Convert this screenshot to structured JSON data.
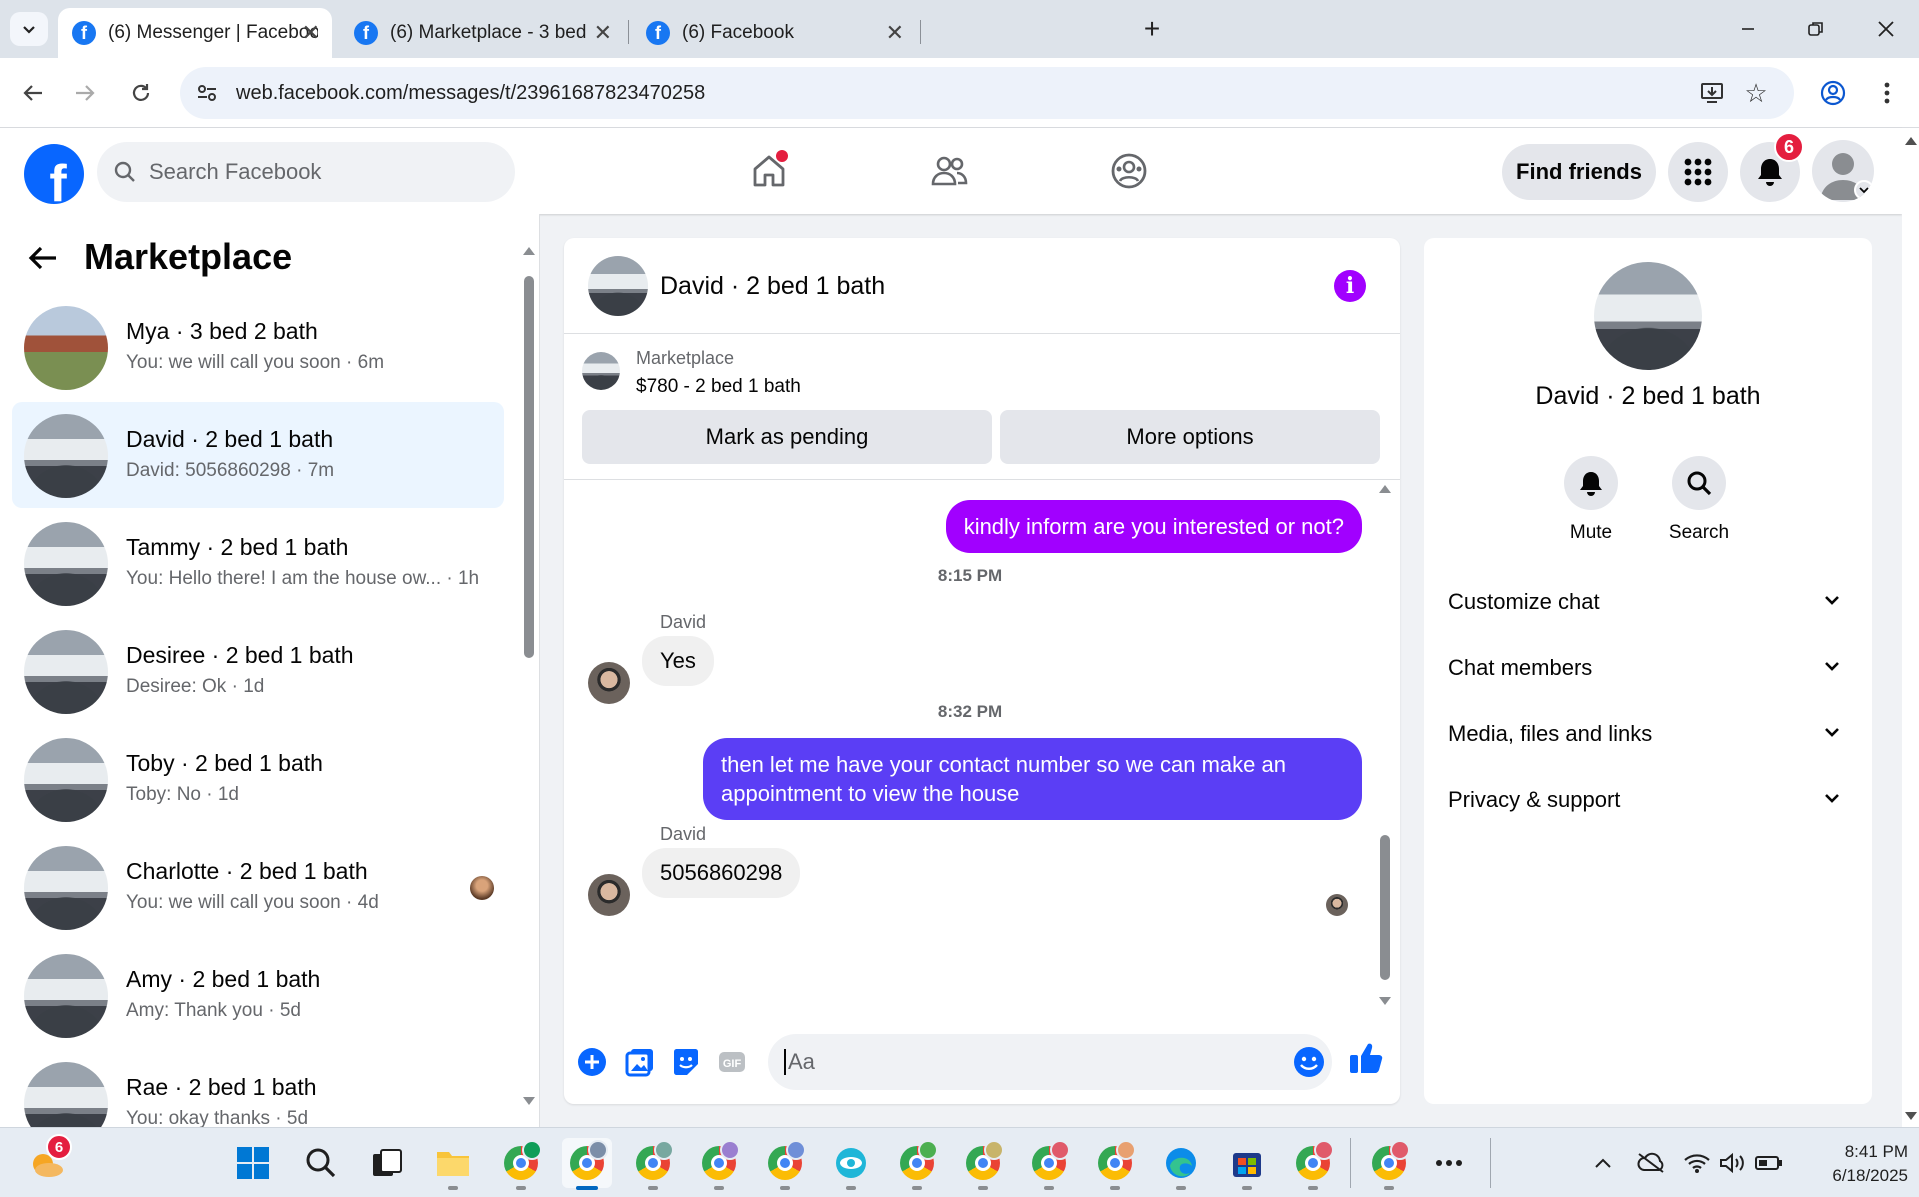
{
  "browser": {
    "tabs": [
      {
        "title": "(6) Messenger | Facebook",
        "active": true
      },
      {
        "title": "(6) Marketplace - 3 bed 2 bath |",
        "active": false
      },
      {
        "title": "(6) Facebook",
        "active": false
      }
    ],
    "url": "web.facebook.com/messages/t/23961687823470258"
  },
  "header": {
    "search_placeholder": "Search Facebook",
    "find_friends": "Find friends",
    "notif_count": "6"
  },
  "sidebar": {
    "title": "Marketplace",
    "conversations": [
      {
        "name": "Mya · 3 bed 2 bath",
        "preview": "You: we will call you soon · 6m",
        "active": false
      },
      {
        "name": "David · 2 bed 1 bath",
        "preview": "David: 5056860298 · 7m",
        "active": true
      },
      {
        "name": "Tammy · 2 bed 1 bath",
        "preview": "You: Hello there! I am the house ow... · 1h",
        "active": false
      },
      {
        "name": "Desiree · 2 bed 1 bath",
        "preview": "Desiree: Ok · 1d",
        "active": false
      },
      {
        "name": "Toby · 2 bed 1 bath",
        "preview": "Toby: No · 1d",
        "active": false
      },
      {
        "name": "Charlotte · 2 bed 1 bath",
        "preview": "You: we will call you soon · 4d",
        "active": false
      },
      {
        "name": "Amy · 2 bed 1 bath",
        "preview": "Amy: Thank you · 5d",
        "active": false
      },
      {
        "name": "Rae · 2 bed 1 bath",
        "preview": "You: okay thanks · 5d",
        "active": false
      }
    ]
  },
  "chat": {
    "title": "David · 2 bed 1 bath",
    "listing_source": "Marketplace",
    "listing_price": "$780 - 2 bed 1 bath",
    "mark_pending": "Mark as pending",
    "more_options": "More options",
    "messages": {
      "out1": "kindly inform are you interested or not?",
      "time1": "8:15 PM",
      "sender1": "David",
      "in1": "Yes",
      "time2": "8:32 PM",
      "out2": "then let me have your contact number so we can make an appointment to view the house",
      "sender2": "David",
      "in2": "5056860298"
    },
    "input_placeholder": "Aa",
    "colors": {
      "out_bubble_1": "#a100ff",
      "out_bubble_2": "#5b3ef5"
    }
  },
  "details": {
    "name": "David · 2 bed 1 bath",
    "mute": "Mute",
    "search": "Search",
    "sections": [
      "Customize chat",
      "Chat members",
      "Media, files and links",
      "Privacy & support"
    ]
  },
  "taskbar": {
    "weather_badge": "6",
    "time": "8:41 PM",
    "date": "6/18/2025"
  }
}
